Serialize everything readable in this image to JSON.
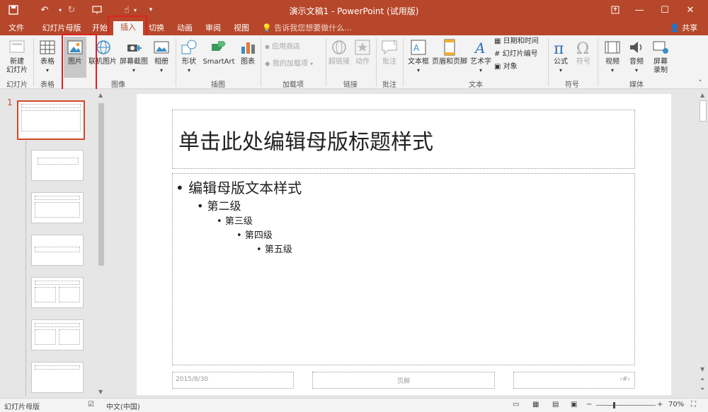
{
  "titlebar": {
    "title": "演示文稿1 - PowerPoint (试用版)",
    "accent": "#b7472a"
  },
  "tabs": [
    "文件",
    "幻灯片母版",
    "开始",
    "插入",
    "切换",
    "动画",
    "审阅",
    "视图"
  ],
  "active_tab": "插入",
  "tell_me": "告诉我您想要做什么...",
  "share": "共享",
  "ribbon": {
    "new_slide": "新建\n幻灯片",
    "table": "表格",
    "picture": "图片",
    "online_picture": "联机图片",
    "screenshot": "屏幕截图",
    "album": "相册",
    "shapes": "形状",
    "smartart": "SmartArt",
    "chart": "图表",
    "store": "应用商店",
    "my_addins": "我的加载项",
    "hyperlink": "超链接",
    "action": "动作",
    "comment": "批注",
    "textbox": "文本框",
    "header_footer": "页眉和页脚",
    "wordart": "艺术字",
    "date_time": "日期和时间",
    "slide_number": "幻灯片编号",
    "object": "对象",
    "equation": "公式",
    "symbol": "符号",
    "video": "视频",
    "audio": "音频",
    "screen_record": "屏幕\n录制",
    "groups": {
      "slides": "幻灯片",
      "tables": "表格",
      "images": "图像",
      "illustrations": "插图",
      "addins": "加载项",
      "links": "链接",
      "comments": "批注",
      "text": "文本",
      "symbols": "符号",
      "media": "媒体"
    }
  },
  "thumbnails": {
    "first_number": "1"
  },
  "slide": {
    "title": "单击此处编辑母版标题样式",
    "levels": [
      "编辑母版文本样式",
      "第二级",
      "第三级",
      "第四级",
      "第五级"
    ],
    "date": "2015/8/30",
    "footer": "页脚",
    "page_num": "‹#›"
  },
  "status": {
    "view": "幻灯片母版",
    "language": "中文(中国)",
    "zoom": "70%"
  }
}
